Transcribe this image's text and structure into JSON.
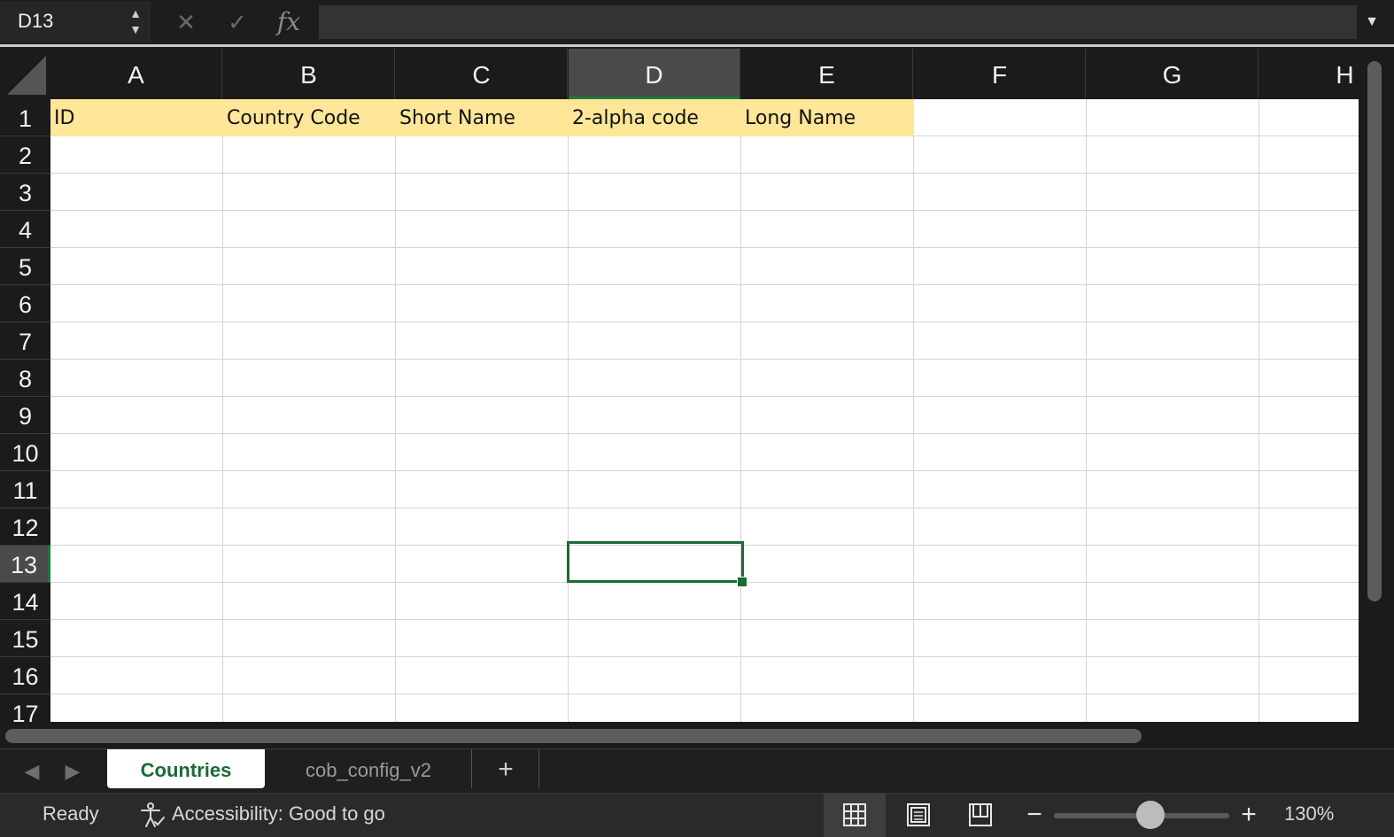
{
  "formula_bar": {
    "name_box": "D13",
    "formula_value": "",
    "fx_label": "fx"
  },
  "columns": [
    "A",
    "B",
    "C",
    "D",
    "E",
    "F",
    "G",
    "H"
  ],
  "selected_column": "D",
  "rows": [
    "1",
    "2",
    "3",
    "4",
    "5",
    "6",
    "7",
    "8",
    "9",
    "10",
    "11",
    "12",
    "13",
    "14",
    "15",
    "16",
    "17"
  ],
  "selected_row": "13",
  "header_row": [
    "ID",
    "Country Code",
    "Short Name",
    "2-alpha code",
    "Long Name"
  ],
  "header_fill": "#ffe699",
  "accent_color": "#1a6b35",
  "sheets": {
    "active": "Countries",
    "other": "cob_config_v2",
    "add_label": "+"
  },
  "status": {
    "ready": "Ready",
    "accessibility": "Accessibility: Good to go",
    "zoom_level": "130%",
    "zoom_fraction": 0.55
  },
  "icons": {
    "cancel": "close-icon",
    "enter": "check-icon",
    "fx": "function-icon",
    "accessibility": "accessibility-icon",
    "normal_view": "grid-view-icon",
    "page_layout": "page-layout-icon",
    "page_break": "page-break-icon"
  }
}
